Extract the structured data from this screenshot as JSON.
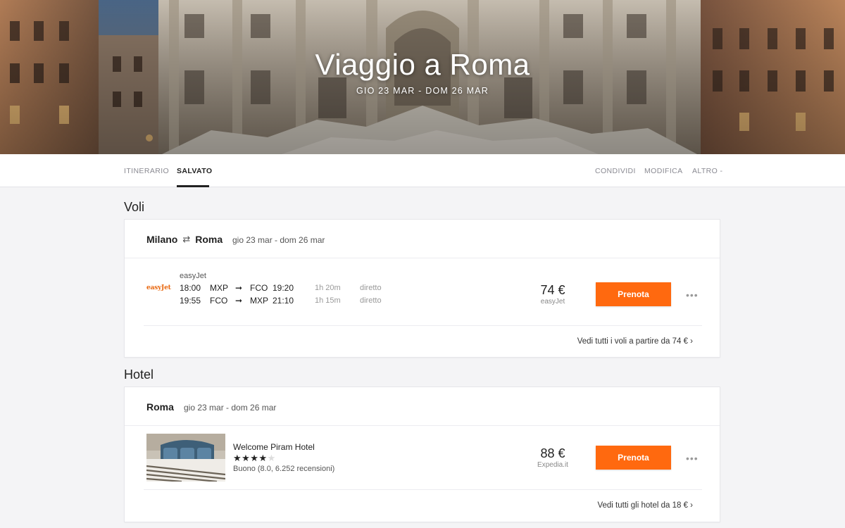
{
  "hero": {
    "title": "Viaggio a Roma",
    "dates": "GIO 23 MAR - DOM 26 MAR"
  },
  "nav": {
    "tabs": [
      {
        "label": "ITINERARIO",
        "active": false
      },
      {
        "label": "SALVATO",
        "active": true
      }
    ],
    "actions": [
      "CONDIVIDI",
      "MODIFICA",
      "ALTRO -"
    ]
  },
  "flights": {
    "section_title": "Voli",
    "origin": "Milano",
    "destination": "Roma",
    "swap_icon": "⇄",
    "dates": "gio 23 mar - dom 26 mar",
    "offer": {
      "airline": "easyJet",
      "logo_text": "easyJet",
      "legs": [
        {
          "dep_time": "18:00",
          "from": "MXP",
          "arrow": "➞",
          "to": "FCO",
          "arr_time": "19:20",
          "duration": "1h 20m",
          "stops": "diretto"
        },
        {
          "dep_time": "19:55",
          "from": "FCO",
          "arrow": "➞",
          "to": "MXP",
          "arr_time": "21:10",
          "duration": "1h 15m",
          "stops": "diretto"
        }
      ],
      "price": "74 €",
      "price_source": "easyJet",
      "book_label": "Prenota",
      "more_label": "•••"
    },
    "see_all": "Vedi tutti i voli a partire da 74 € ›"
  },
  "hotels": {
    "section_title": "Hotel",
    "city": "Roma",
    "dates": "gio 23 mar - dom 26 mar",
    "offer": {
      "name": "Welcome Piram Hotel",
      "stars_on": "★★★★",
      "stars_off": "★",
      "star_rating": 4,
      "rating_text": "Buono (8.0, 6.252 recensioni)",
      "price": "88 €",
      "price_source": "Expedia.it",
      "book_label": "Prenota",
      "more_label": "•••"
    },
    "see_all": "Vedi tutti gli hotel da 18 € ›"
  },
  "colors": {
    "accent": "#ff690f",
    "logo": "#e8660d"
  }
}
